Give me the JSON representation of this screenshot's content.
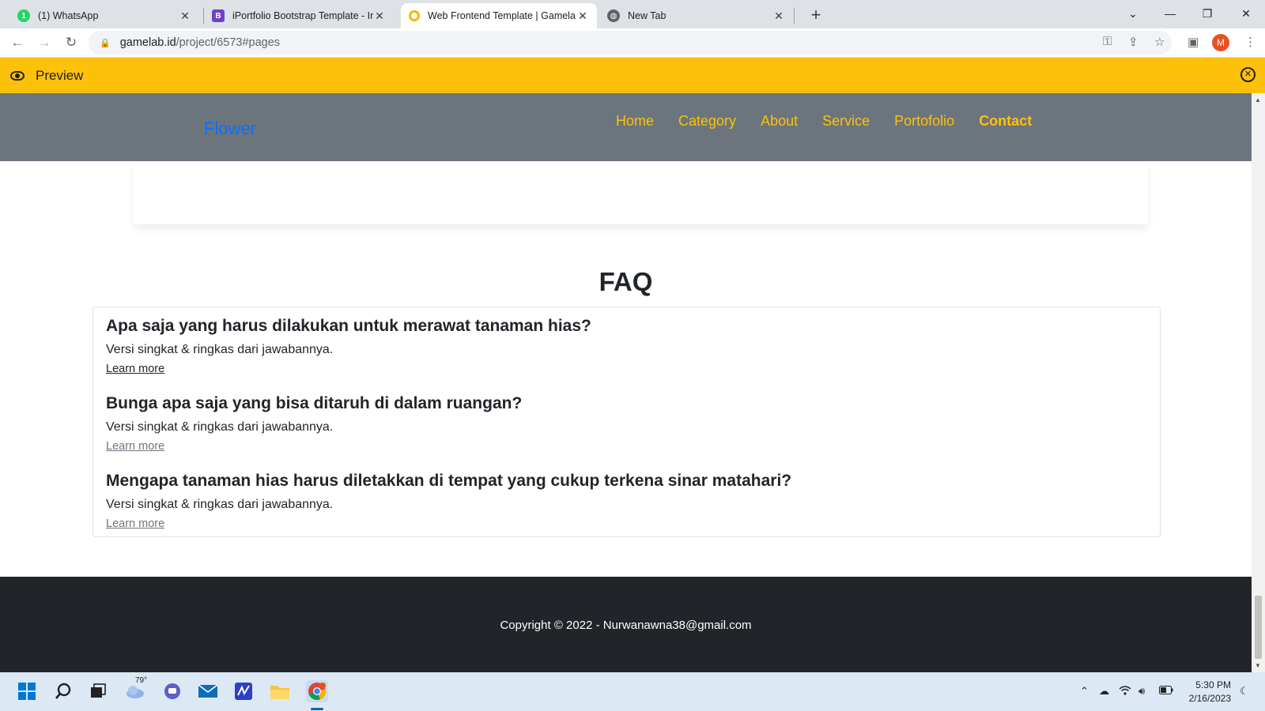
{
  "browser": {
    "tabs": [
      {
        "title": "(1) WhatsApp",
        "icon": "whatsapp-icon",
        "active": false
      },
      {
        "title": "iPortfolio Bootstrap Template - In",
        "icon": "bootstrap-icon",
        "active": false
      },
      {
        "title": "Web Frontend Template | Gamela",
        "icon": "gamelab-icon",
        "active": true
      },
      {
        "title": "New Tab",
        "icon": "globe-icon",
        "active": false
      }
    ],
    "url_host": "gamelab.id",
    "url_path": "/project/6573#pages",
    "profile_initial": "M"
  },
  "preview_bar": {
    "label": "Preview",
    "color": "#fdc10a"
  },
  "site": {
    "brand": "Flower",
    "nav": [
      "Home",
      "Category",
      "About",
      "Service",
      "Portofolio",
      "Contact"
    ],
    "active_nav": "Contact",
    "faq": {
      "title": "FAQ",
      "items": [
        {
          "question": "Apa saja yang harus dilakukan untuk merawat tanaman hias?",
          "answer": "Versi singkat & ringkas dari jawabannya.",
          "link": "Learn more"
        },
        {
          "question": "Bunga apa saja yang bisa ditaruh di dalam ruangan?",
          "answer": "Versi singkat & ringkas dari jawabannya.",
          "link": "Learn more"
        },
        {
          "question": "Mengapa tanaman hias harus diletakkan di tempat yang cukup terkena sinar matahari?",
          "answer": "Versi singkat & ringkas dari jawabannya.",
          "link": "Learn more"
        }
      ]
    },
    "footer": "Copyright © 2022 - Nurwanawna38@gmail.com",
    "colors": {
      "navbar": "#6c757d",
      "nav_link": "#ffc107",
      "brand": "#0d6efd",
      "footer": "#212529"
    }
  },
  "taskbar": {
    "weather_temp": "79°",
    "time": "5:30 PM",
    "date": "2/16/2023"
  }
}
